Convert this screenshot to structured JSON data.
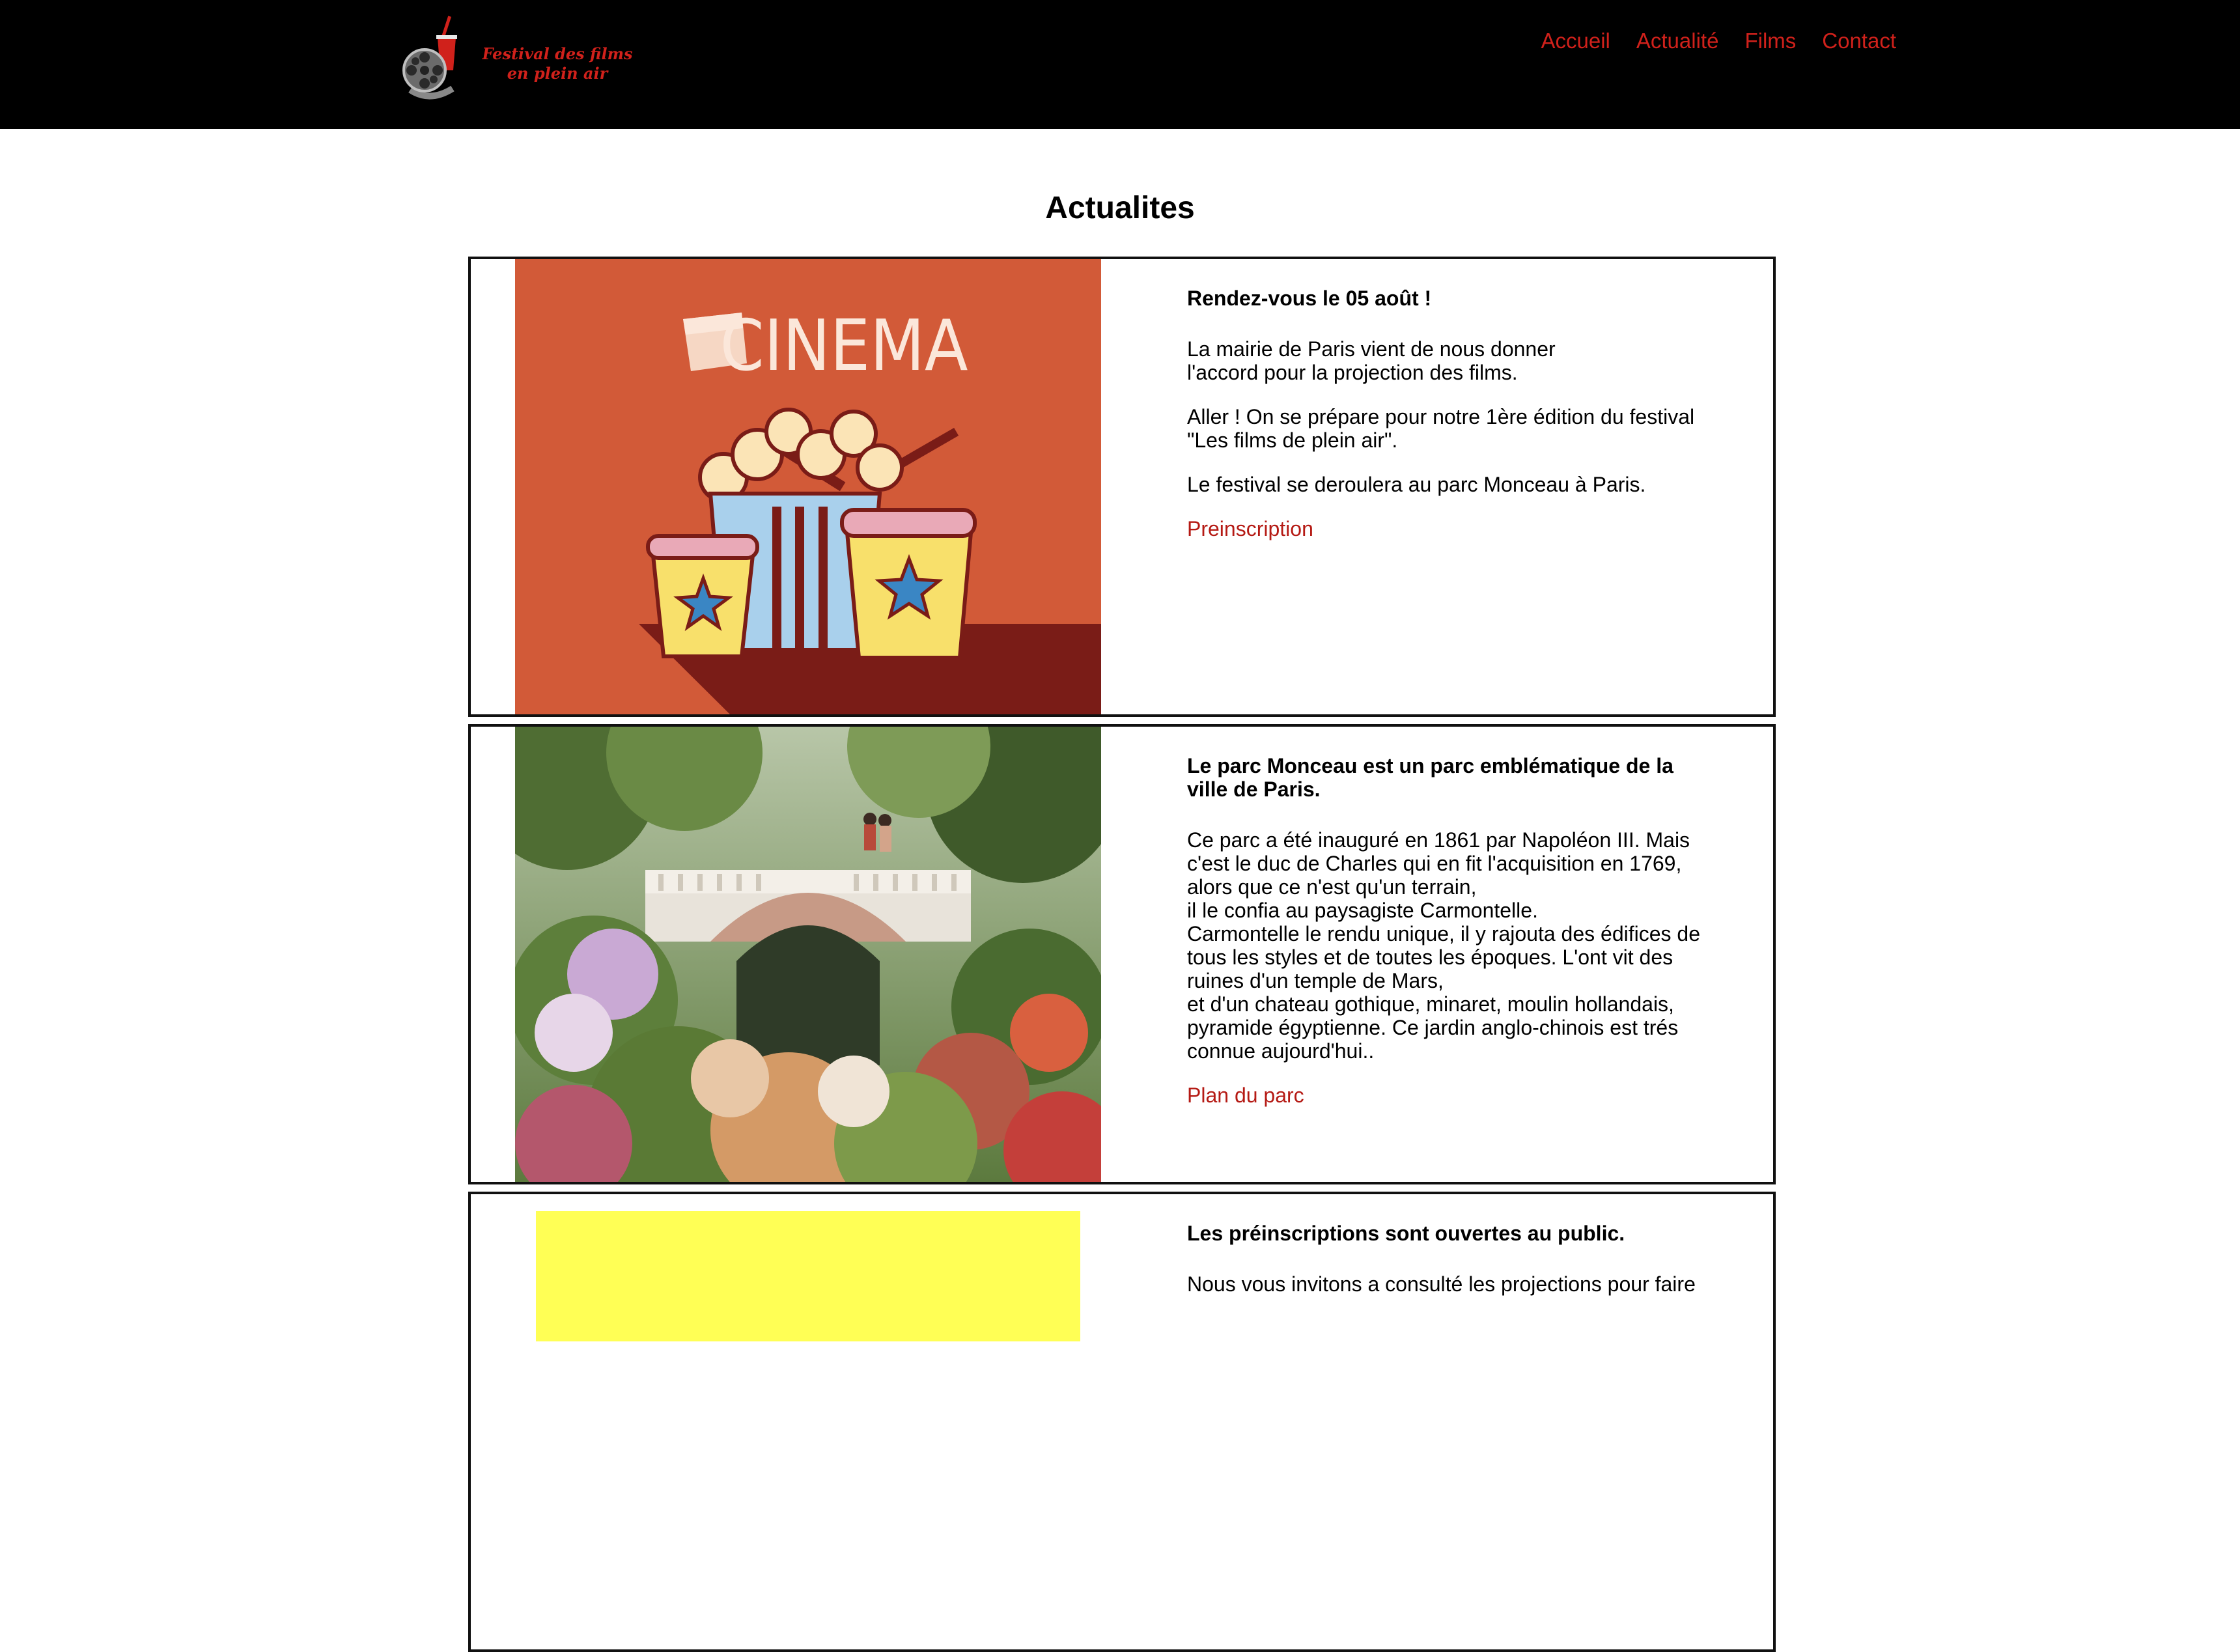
{
  "header": {
    "logo_line1": "Festival des films",
    "logo_line2": "en plein air",
    "nav": [
      "Accueil",
      "Actualité",
      "Films",
      "Contact"
    ]
  },
  "main": {
    "title": "Actualites",
    "articles": [
      {
        "heading": "Rendez-vous le 05 août !",
        "paragraphs": [
          "La mairie de Paris vient de nous donner\nl'accord pour la projection des films.",
          "Aller ! On se prépare pour notre 1ère édition du festival\n\"Les films de plein air\".",
          "Le festival se deroulera au parc Monceau à Paris."
        ],
        "link": "Preinscription",
        "image_text": "CINEMA"
      },
      {
        "heading": "Le parc Monceau est un parc emblématique de la\nville de Paris.",
        "paragraphs": [
          "Ce parc a été inauguré en 1861 par Napoléon III. Mais\nc'est le duc de Charles qui en fit l'acquisition en 1769,\nalors que ce n'est qu'un terrain,\nil le confia au paysagiste Carmontelle.\nCarmontelle le rendu unique, il y rajouta des édifices de\ntous les styles et de toutes les époques. L'ont vit des\nruines d'un temple de Mars,\net d'un chateau gothique, minaret, moulin hollandais,\npyramide égyptienne. Ce jardin anglo-chinois est trés\nconnue aujourd'hui.."
        ],
        "link": "Plan du parc"
      },
      {
        "heading": "Les préinscriptions sont ouvertes au public.",
        "paragraphs": [
          "Nous vous invitons a consulté les projections pour faire"
        ]
      }
    ]
  },
  "colors": {
    "header_bg": "#000000",
    "accent": "#d0211b",
    "link": "#b51a14",
    "cinema_bg": "#d25a38",
    "highlight_yellow": "#ffff55"
  }
}
